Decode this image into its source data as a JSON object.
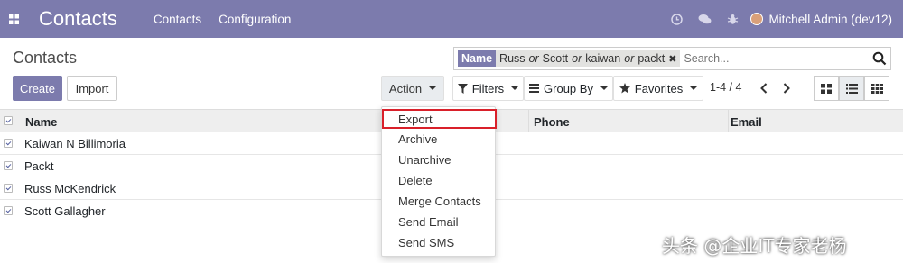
{
  "navbar": {
    "brand": "Contacts",
    "menu": [
      "Contacts",
      "Configuration"
    ],
    "user": "Mitchell Admin (dev12)",
    "icons": [
      "clock-icon",
      "chat-icon",
      "bug-icon"
    ]
  },
  "control_panel": {
    "breadcrumb": "Contacts",
    "create_label": "Create",
    "import_label": "Import",
    "action_label": "Action",
    "filters_label": "Filters",
    "groupby_label": "Group By",
    "favorites_label": "Favorites",
    "pager": "1-4 / 4"
  },
  "search": {
    "facet_label": "Name",
    "facet_values": [
      "Russ",
      "Scott",
      "kaiwan",
      "packt"
    ],
    "facet_separator": "or",
    "placeholder": "Search..."
  },
  "list": {
    "columns": [
      "Name",
      "Phone",
      "Email"
    ],
    "rows": [
      "Kaiwan N Billimoria",
      "Packt",
      "Russ McKendrick",
      "Scott Gallagher"
    ]
  },
  "action_menu": {
    "items": [
      "Export",
      "Archive",
      "Unarchive",
      "Delete",
      "Merge Contacts",
      "Send Email",
      "Send SMS"
    ],
    "highlighted": "Export"
  },
  "watermark": "头条 @企业IT专家老杨",
  "colors": {
    "brand": "#7c7bad",
    "highlight_border": "#d9202a"
  }
}
